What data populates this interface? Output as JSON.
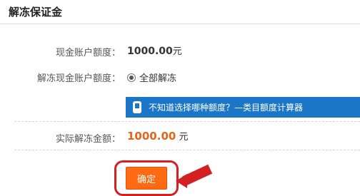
{
  "page": {
    "title": "解冻保证金"
  },
  "form": {
    "cash_account_label": "现金账户额度：",
    "cash_account_amount": "1000.00",
    "cash_account_unit": "元",
    "unfreeze_label": "解冻现金账户额度：",
    "unfreeze_option": "全部解冻",
    "tip_text": "不知道选择哪种额度？—类目额度计算器",
    "actual_label": "实际解冻金额：",
    "actual_amount": "1000.00",
    "actual_unit": "元"
  },
  "actions": {
    "confirm_label": "确定"
  },
  "colors": {
    "tip_bar": "#1b76c8",
    "confirm_button": "#ff6a12",
    "highlight": "#d42020",
    "amount_orange": "#e8641b"
  },
  "icons": {
    "tip": "calculator-icon",
    "radio": "radio-selected-icon"
  }
}
